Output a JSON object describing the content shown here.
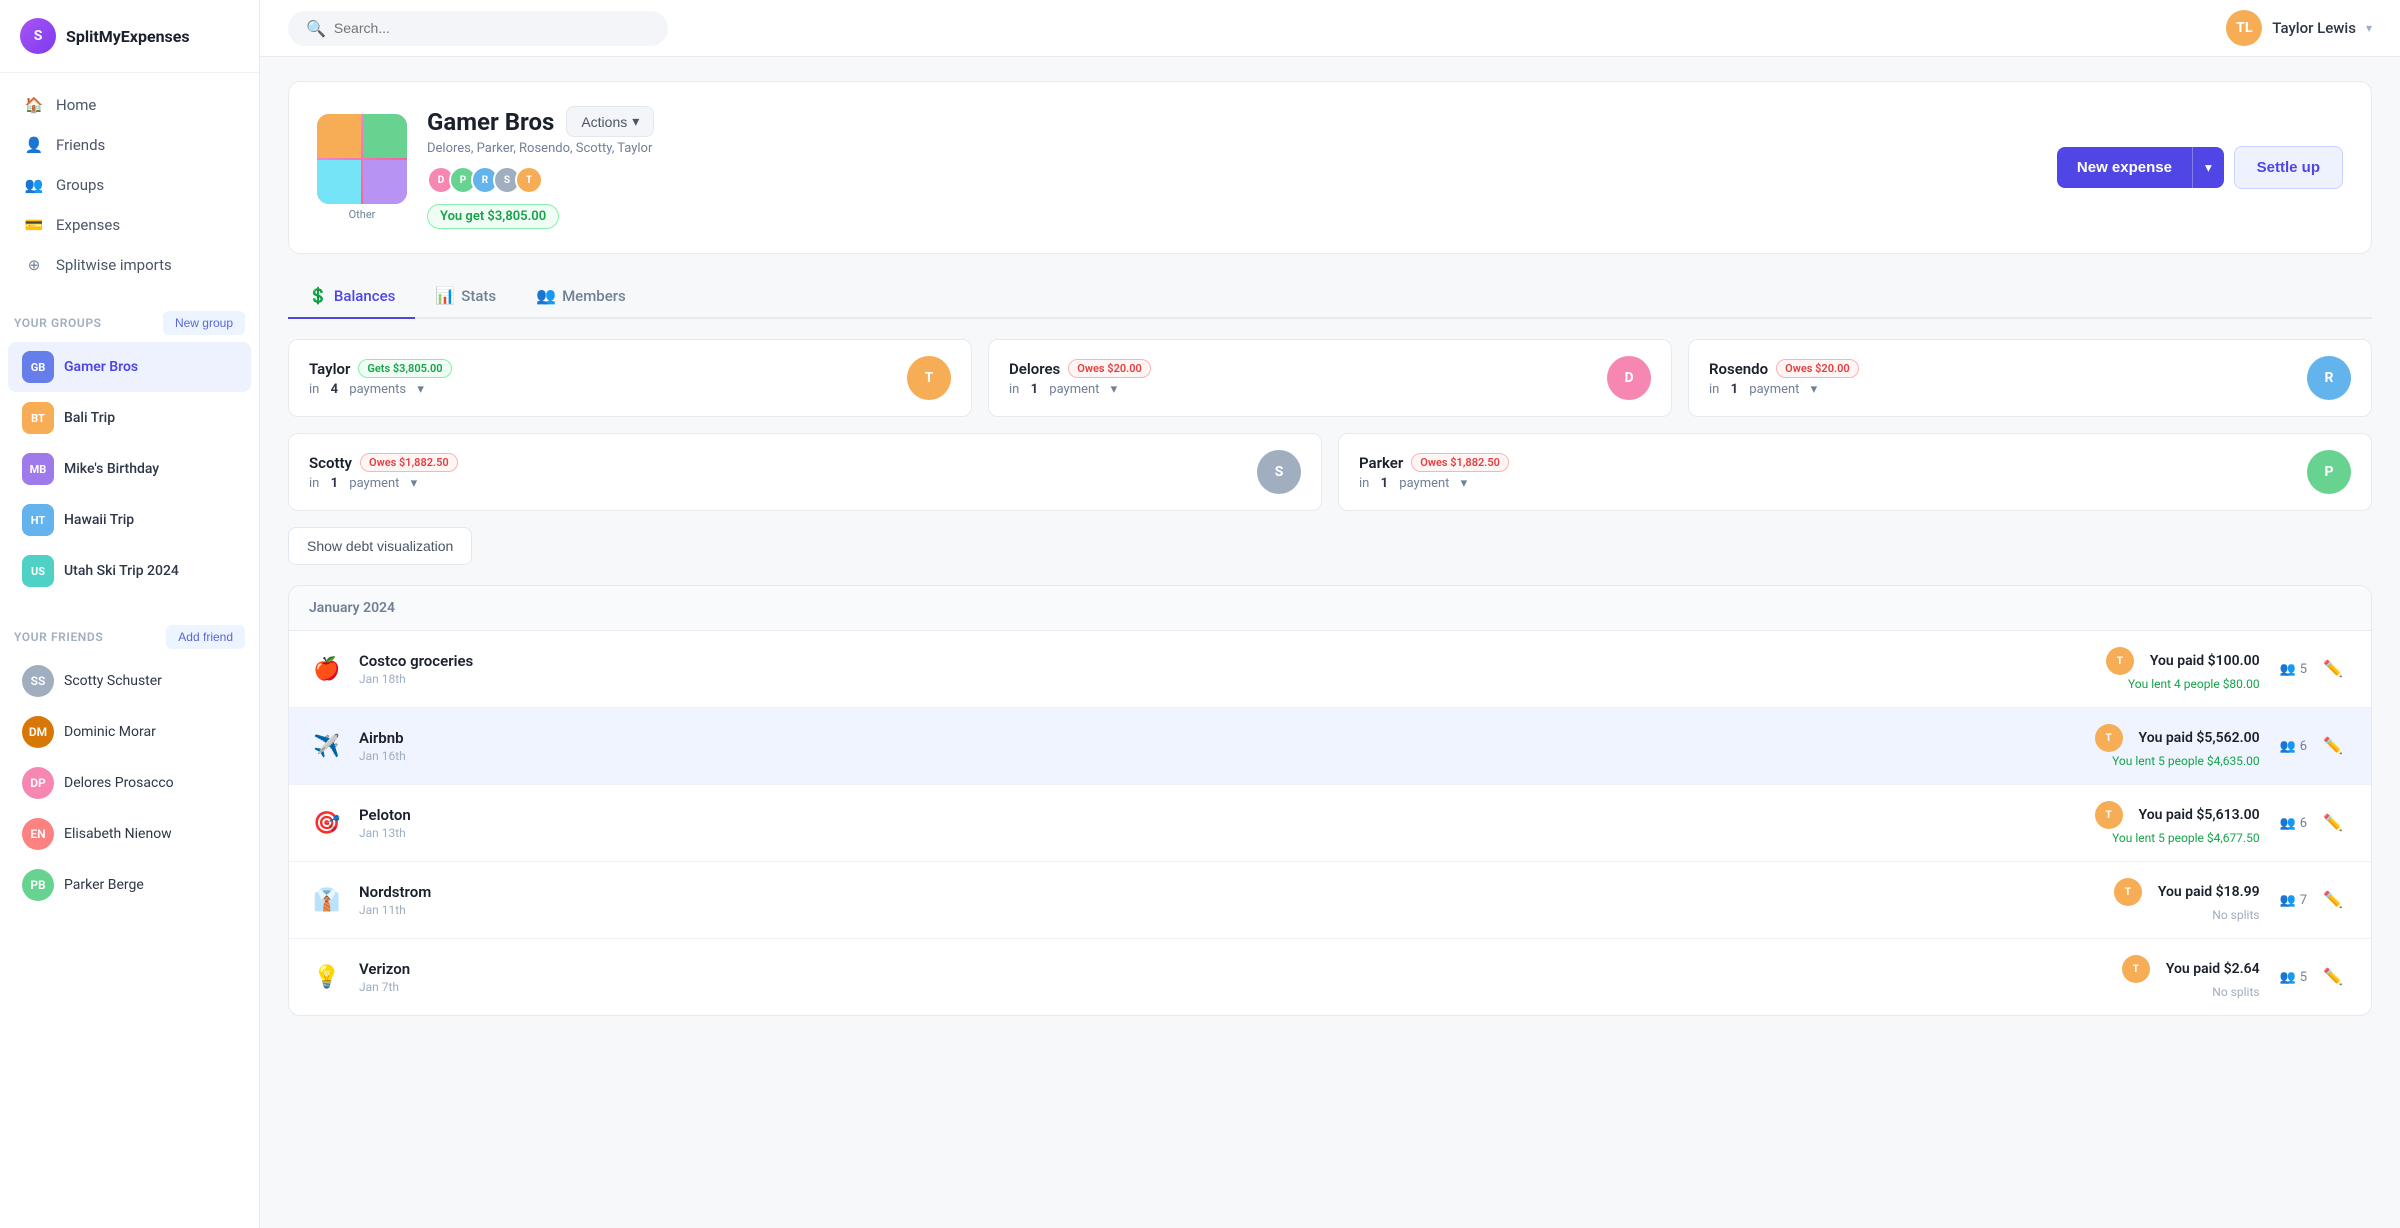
{
  "app": {
    "name": "SplitMyExpenses",
    "logo_initial": "S"
  },
  "topbar": {
    "search_placeholder": "Search...",
    "user_name": "Taylor Lewis",
    "user_initial": "TL"
  },
  "sidebar": {
    "nav_items": [
      {
        "id": "home",
        "label": "Home",
        "icon": "home"
      },
      {
        "id": "friends",
        "label": "Friends",
        "icon": "user"
      },
      {
        "id": "groups",
        "label": "Groups",
        "icon": "users"
      },
      {
        "id": "expenses",
        "label": "Expenses",
        "icon": "credit-card"
      },
      {
        "id": "splitwise",
        "label": "Splitwise imports",
        "icon": "plus-circle"
      }
    ],
    "your_groups_label": "Your groups",
    "new_group_label": "New group",
    "groups": [
      {
        "id": "gamer-bros",
        "name": "Gamer Bros",
        "active": true,
        "color": "av-indigo"
      },
      {
        "id": "bali-trip",
        "name": "Bali Trip",
        "active": false,
        "color": "av-orange"
      },
      {
        "id": "mikes-birthday",
        "name": "Mike's Birthday",
        "active": false,
        "color": "av-purple"
      },
      {
        "id": "hawaii-trip",
        "name": "Hawaii Trip",
        "active": false,
        "color": "av-blue"
      },
      {
        "id": "utah-ski",
        "name": "Utah Ski Trip 2024",
        "active": false,
        "color": "av-teal"
      }
    ],
    "your_friends_label": "Your friends",
    "add_friend_label": "Add friend",
    "friends": [
      {
        "id": "scotty",
        "name": "Scotty Schuster",
        "initial": "SS",
        "color": "av-gray"
      },
      {
        "id": "dominic",
        "name": "Dominic Morar",
        "initial": "DM",
        "color": "av-brown"
      },
      {
        "id": "delores",
        "name": "Delores Prosacco",
        "initial": "DP",
        "color": "av-pink"
      },
      {
        "id": "elisabeth",
        "name": "Elisabeth Nienow",
        "initial": "EN",
        "color": "av-red"
      },
      {
        "id": "parker",
        "name": "Parker Berge",
        "initial": "PB",
        "color": "av-green"
      }
    ]
  },
  "group": {
    "name": "Gamer Bros",
    "other_label": "Other",
    "members_text": "Delores, Parker, Rosendo, Scotty, Taylor",
    "members": [
      {
        "initial": "D",
        "color": "av-pink"
      },
      {
        "initial": "P",
        "color": "av-green"
      },
      {
        "initial": "R",
        "color": "av-blue"
      },
      {
        "initial": "S",
        "color": "av-gray"
      },
      {
        "initial": "T",
        "color": "av-orange"
      }
    ],
    "balance": "You get $3,805.00",
    "actions_label": "Actions",
    "new_expense_label": "New expense",
    "settle_up_label": "Settle up"
  },
  "tabs": [
    {
      "id": "balances",
      "label": "Balances",
      "active": true,
      "icon": "💲"
    },
    {
      "id": "stats",
      "label": "Stats",
      "active": false,
      "icon": "📊"
    },
    {
      "id": "members",
      "label": "Members",
      "active": false,
      "icon": "👥"
    }
  ],
  "balances": [
    {
      "name": "Taylor",
      "badge_type": "gets",
      "badge_label": "Gets $3,805.00",
      "payments_text": "in",
      "payments_count": "4",
      "payments_suffix": "payments",
      "avatar_initial": "T",
      "avatar_color": "av-orange"
    },
    {
      "name": "Delores",
      "badge_type": "owes",
      "badge_label": "Owes $20.00",
      "payments_text": "in",
      "payments_count": "1",
      "payments_suffix": "payment",
      "avatar_initial": "D",
      "avatar_color": "av-pink"
    },
    {
      "name": "Rosendo",
      "badge_type": "owes",
      "badge_label": "Owes $20.00",
      "payments_text": "in",
      "payments_count": "1",
      "payments_suffix": "payment",
      "avatar_initial": "R",
      "avatar_color": "av-blue"
    },
    {
      "name": "Scotty",
      "badge_type": "owes",
      "badge_label": "Owes $1,882.50",
      "payments_text": "in",
      "payments_count": "1",
      "payments_suffix": "payment",
      "avatar_initial": "S",
      "avatar_color": "av-gray"
    },
    {
      "name": "Parker",
      "badge_type": "owes",
      "badge_label": "Owes $1,882.50",
      "payments_text": "in",
      "payments_count": "1",
      "payments_suffix": "payment",
      "avatar_initial": "P",
      "avatar_color": "av-green"
    }
  ],
  "debt_viz_label": "Show debt visualization",
  "expenses": {
    "month_header": "January 2024",
    "items": [
      {
        "id": "costco",
        "emoji": "🍎",
        "name": "Costco groceries",
        "date": "Jan 18th",
        "you_paid": "You paid $100.00",
        "you_lent": "You lent 4 people $80.00",
        "split_count": "5",
        "has_splits": true
      },
      {
        "id": "airbnb",
        "emoji": "✈️",
        "name": "Airbnb",
        "date": "Jan 16th",
        "you_paid": "You paid $5,562.00",
        "you_lent": "You lent 5 people $4,635.00",
        "split_count": "6",
        "has_splits": true
      },
      {
        "id": "peloton",
        "emoji": "🎯",
        "name": "Peloton",
        "date": "Jan 13th",
        "you_paid": "You paid $5,613.00",
        "you_lent": "You lent 5 people $4,677.50",
        "split_count": "6",
        "has_splits": true
      },
      {
        "id": "nordstrom",
        "emoji": "👔",
        "name": "Nordstrom",
        "date": "Jan 11th",
        "you_paid": "You paid $18.99",
        "you_lent": "",
        "no_splits_label": "No splits",
        "split_count": "7",
        "has_splits": false
      },
      {
        "id": "verizon",
        "emoji": "💡",
        "name": "Verizon",
        "date": "Jan 7th",
        "you_paid": "You paid $2.64",
        "you_lent": "",
        "no_splits_label": "No splits",
        "split_count": "5",
        "has_splits": false
      }
    ]
  }
}
